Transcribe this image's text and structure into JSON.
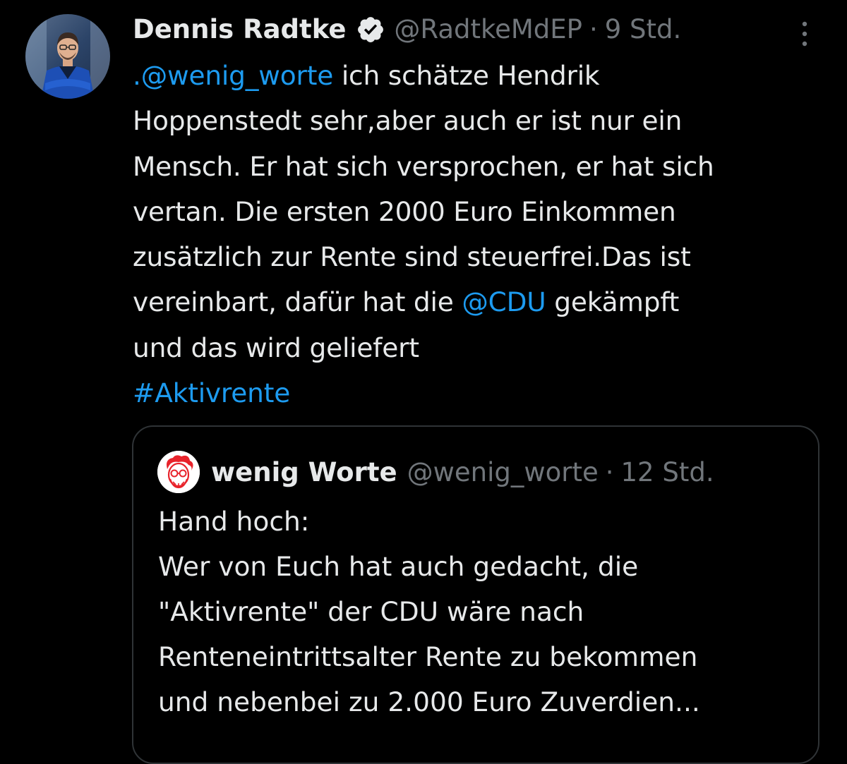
{
  "tweet": {
    "author": {
      "display_name": "Dennis Radtke",
      "handle": "@RadtkeMdEP",
      "separator": "·",
      "time": "9 Std.",
      "verified_icon": "verified-badge-icon"
    },
    "more_icon": "more-vertical-icon",
    "lines": [
      {
        "mention": ".@wenig_worte",
        "text": " ich schätze Hendrik"
      },
      {
        "text": "Hoppenstedt sehr,aber auch er ist nur ein"
      },
      {
        "text": "Mensch. Er hat sich versprochen, er hat sich"
      },
      {
        "text": "vertan. Die ersten 2000 Euro Einkommen"
      },
      {
        "text": "zusätzlich zur Rente sind steuerfrei.Das ist"
      },
      {
        "pre": "vereinbart, dafür hat die ",
        "mention": "@CDU",
        "post": " gekämpft"
      },
      {
        "text": "und das wird geliefert"
      },
      {
        "hashtag": "#Aktivrente"
      }
    ]
  },
  "quote": {
    "author": {
      "display_name": "wenig Worte",
      "handle": "@wenig_worte",
      "separator": "·",
      "time": "12 Std."
    },
    "lines": [
      "Hand hoch:",
      "Wer von Euch hat auch gedacht, die",
      "\"Aktivrente\" der CDU wäre nach",
      "Renteneintrittsalter Rente zu bekommen",
      "und nebenbei zu 2.000 Euro Zuverdien..."
    ]
  },
  "colors": {
    "background": "#000000",
    "text": "#e7e9ea",
    "muted": "#71767b",
    "link": "#1d9bf0",
    "border": "#2f3336"
  }
}
